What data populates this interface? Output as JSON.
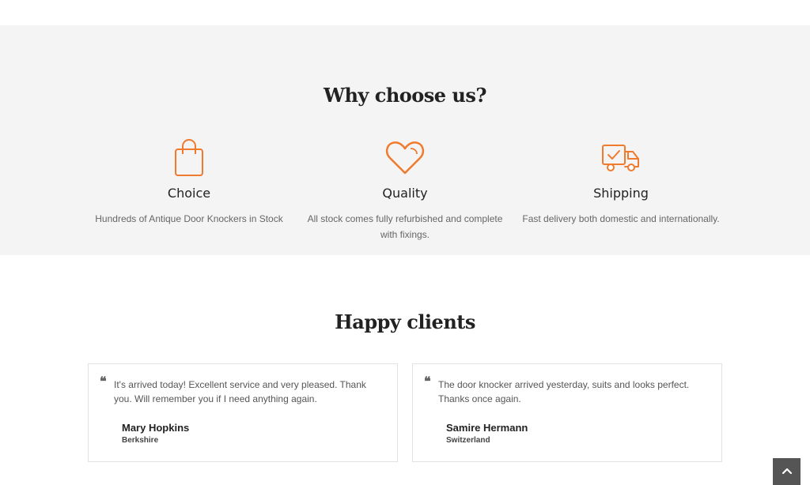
{
  "why": {
    "title": "Why choose us?",
    "features": [
      {
        "icon": "shopping-bag-icon",
        "label": "Choice",
        "desc": "Hundreds of Antique Door Knockers in Stock"
      },
      {
        "icon": "heart-icon",
        "label": "Quality",
        "desc": "All stock comes fully refurbished and complete with fixings."
      },
      {
        "icon": "delivery-truck-icon",
        "label": "Shipping",
        "desc": "Fast delivery both domestic and internationally."
      }
    ]
  },
  "clients": {
    "title": "Happy clients",
    "quote_mark": "❝",
    "testimonials": [
      {
        "text": "It's arrived today! Excellent service and very pleased. Thank you. Will remember you if I need anything again.",
        "name": "Mary Hopkins",
        "place": "Berkshire"
      },
      {
        "text": "The door knocker arrived yesterday, suits and looks perfect. Thanks once again.",
        "name": "Samire Hermann",
        "place": "Switzerland"
      }
    ]
  },
  "scroll_top": {
    "icon": "chevron-up-icon"
  },
  "colors": {
    "accent": "#f07a2e",
    "section_bg": "#f4f4f4",
    "scroll_button": "#555555"
  }
}
